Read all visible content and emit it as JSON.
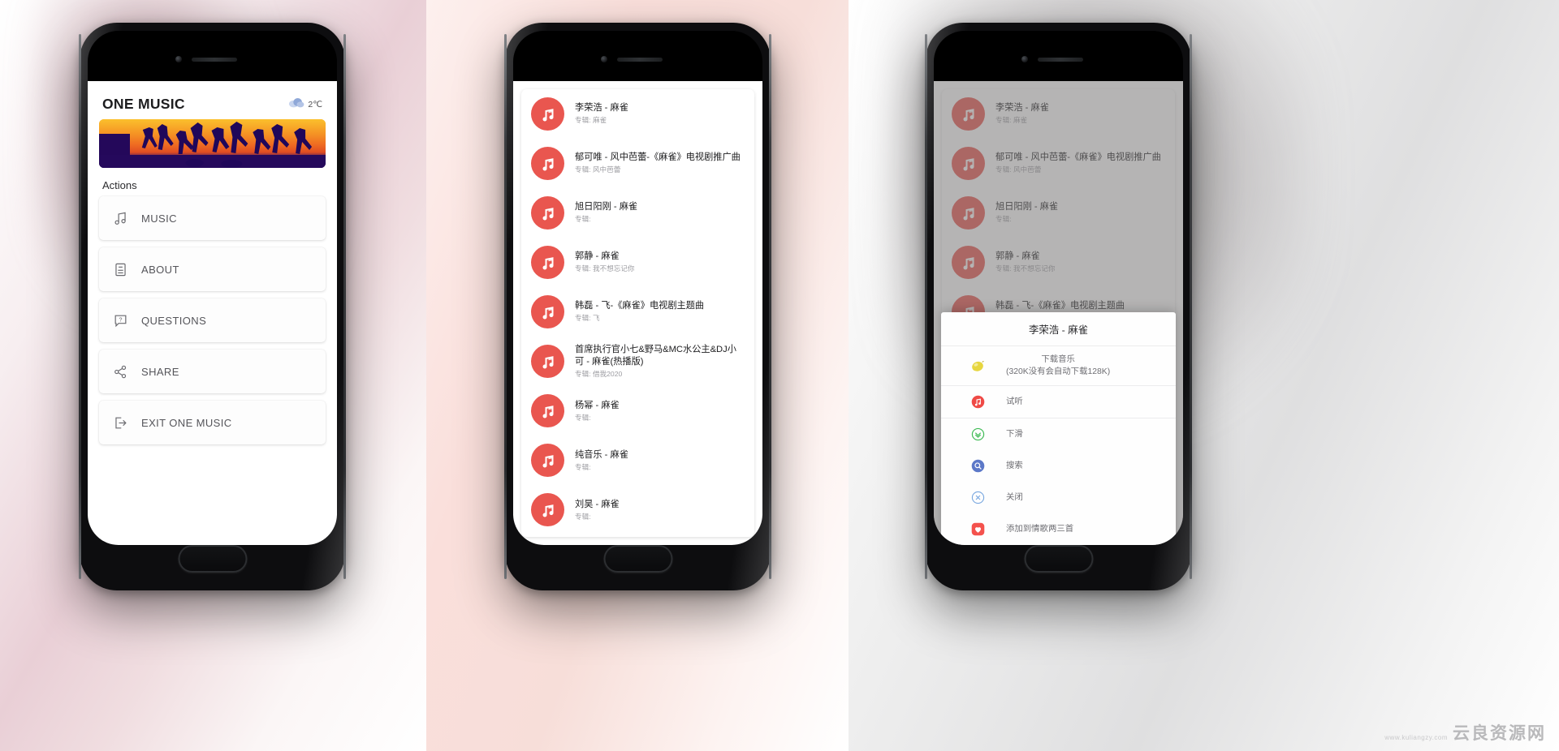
{
  "phone1": {
    "app_title": "ONE MUSIC",
    "weather": {
      "icon": "cloud-icon",
      "temperature": "2℃"
    },
    "banner_alt": "silhouette-dancers-sunset-banner",
    "section_label": "Actions",
    "actions": [
      {
        "icon": "music-note-icon",
        "label": "MUSIC"
      },
      {
        "icon": "document-icon",
        "label": "ABOUT"
      },
      {
        "icon": "question-bubble-icon",
        "label": "QUESTIONS"
      },
      {
        "icon": "share-icon",
        "label": "SHARE"
      },
      {
        "icon": "exit-icon",
        "label": "EXIT ONE MUSIC"
      }
    ]
  },
  "phone2": {
    "album_prefix": "专辑:",
    "songs": [
      {
        "name": "李荣浩 - 麻雀",
        "album": "专辑: 麻雀"
      },
      {
        "name": "郁可唯 - 风中芭蕾-《麻雀》电视剧推广曲",
        "album": "专辑: 风中芭蕾"
      },
      {
        "name": "旭日阳刚 - 麻雀",
        "album": "专辑:"
      },
      {
        "name": "郭静 - 麻雀",
        "album": "专辑: 我不想忘记你"
      },
      {
        "name": "韩磊 - 飞-《麻雀》电视剧主题曲",
        "album": "专辑: 飞"
      },
      {
        "name": "首席执行官小七&野马&MC水公主&DJ小可 - 麻雀(热播版)",
        "album": "专辑: 借我2020"
      },
      {
        "name": "杨幂 - 麻雀",
        "album": "专辑:"
      },
      {
        "name": "纯音乐 - 麻雀",
        "album": "专辑:"
      },
      {
        "name": "刘昊 - 麻雀",
        "album": "专辑:"
      }
    ]
  },
  "phone3": {
    "dialog": {
      "title": "李荣浩 - 麻雀",
      "items": [
        {
          "icon": "lemon-icon",
          "label": "下载音乐",
          "sublabel": "(320K没有会自动下载128K)"
        },
        {
          "icon": "music-note-red-icon",
          "label": "试听"
        },
        {
          "icon": "chevron-down-circle-icon",
          "label": "下滑"
        },
        {
          "icon": "search-circle-icon",
          "label": "搜索"
        },
        {
          "icon": "close-circle-icon",
          "label": "关闭"
        },
        {
          "icon": "heart-icon",
          "label": "添加到情歌两三首"
        }
      ]
    }
  },
  "watermark": {
    "main": "云良资源网",
    "sub": "www.kuliangzy.com"
  },
  "colors": {
    "accent_red": "#e9564f",
    "heart_red": "#f4524d",
    "green": "#3fbb55",
    "blue": "#5c78c8",
    "light_blue": "#7aa8e0",
    "lemon": "#e8d84a"
  }
}
